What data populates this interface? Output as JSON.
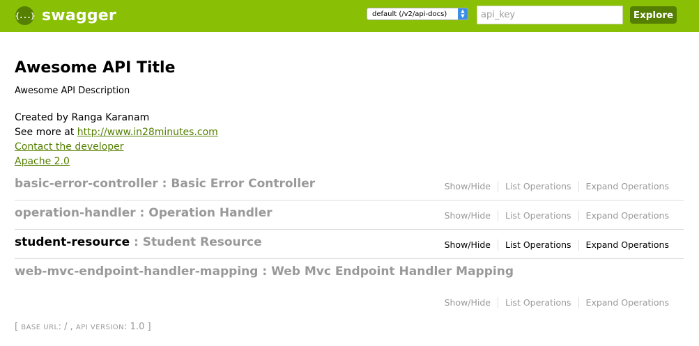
{
  "header": {
    "logo_glyph": "{...}",
    "logo_text": "swagger",
    "spec_select": "default (/v2/api-docs)",
    "api_key_placeholder": "api_key",
    "explore_label": "Explore",
    "colors": {
      "bar": "#89bf04",
      "dark_green": "#547f00"
    }
  },
  "info": {
    "title": "Awesome API Title",
    "description": "Awesome API Description",
    "created_by": "Created by Ranga Karanam",
    "see_more_prefix": "See more at ",
    "see_more_link": "http://www.in28minutes.com",
    "contact_link": "Contact the developer",
    "license_link": "Apache 2.0"
  },
  "resources": [
    {
      "name": "basic-error-controller",
      "sep": " : ",
      "description": "Basic Error Controller",
      "active": false,
      "ops": [
        "Show/Hide",
        "List Operations",
        "Expand Operations"
      ]
    },
    {
      "name": "operation-handler",
      "sep": " : ",
      "description": "Operation Handler",
      "active": false,
      "ops": [
        "Show/Hide",
        "List Operations",
        "Expand Operations"
      ]
    },
    {
      "name": "student-resource",
      "sep": " : ",
      "description": "Student Resource",
      "active": true,
      "ops": [
        "Show/Hide",
        "List Operations",
        "Expand Operations"
      ]
    },
    {
      "name": "web-mvc-endpoint-handler-mapping",
      "sep": " : ",
      "description": "Web Mvc Endpoint Handler Mapping",
      "active": false,
      "ops": [
        "Show/Hide",
        "List Operations",
        "Expand Operations"
      ]
    }
  ],
  "footer": {
    "open": "[ ",
    "base_url_label": "BASE URL",
    "base_url_value": ": / , ",
    "api_version_label": "API VERSION",
    "api_version_value": ": 1.0 ]"
  }
}
